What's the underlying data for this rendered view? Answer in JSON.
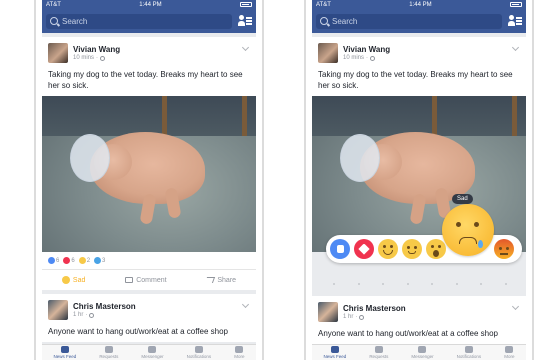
{
  "status_bar": {
    "carrier": "AT&T",
    "time": "1:44 PM"
  },
  "nav": {
    "search_placeholder": "Search"
  },
  "post1": {
    "author": "Vivian Wang",
    "time": "10 mins",
    "text": "Taking my dog to the vet today. Breaks my heart to see her so sick.",
    "reaction_counts": {
      "like": "6",
      "love": "6",
      "haha": "2",
      "wow": "3"
    },
    "actions": {
      "sad": "Sad",
      "comment": "Comment",
      "share": "Share"
    }
  },
  "post2": {
    "author": "Chris Masterson",
    "time": "1 hr",
    "text": "Anyone want to hang out/work/eat at a coffee shop"
  },
  "tabs": [
    {
      "label": "News Feed",
      "active": true
    },
    {
      "label": "Requests",
      "active": false
    },
    {
      "label": "Messenger",
      "active": false
    },
    {
      "label": "Notifications",
      "active": false
    },
    {
      "label": "More",
      "active": false
    }
  ],
  "reaction_picker": {
    "tooltip": "Sad",
    "reactions": [
      "like",
      "love",
      "haha",
      "yay",
      "wow",
      "sad",
      "angry"
    ],
    "selected": "sad"
  },
  "colors": {
    "brand": "#3b5998",
    "sad_accent": "#f7b125"
  }
}
